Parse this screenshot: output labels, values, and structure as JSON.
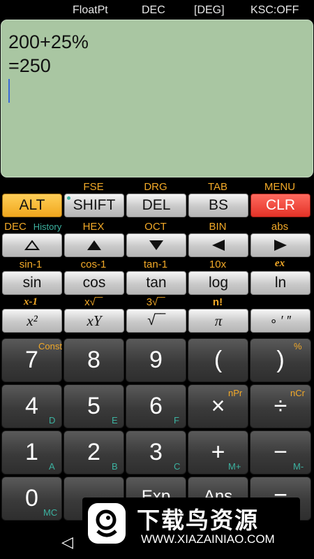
{
  "status": {
    "mode": "FloatPt",
    "base": "DEC",
    "angle": "[DEG]",
    "ksc": "KSC:OFF"
  },
  "display": {
    "expression": "200+25%",
    "result": "=250"
  },
  "row1": {
    "above": [
      "",
      "FSE",
      "DRG",
      "TAB",
      "MENU"
    ],
    "keys": [
      "ALT",
      "SHIFT",
      "DEL",
      "BS",
      "CLR"
    ]
  },
  "row2": {
    "above": [
      "DEC",
      "History",
      "HEX",
      "OCT",
      "BIN",
      "abs"
    ]
  },
  "row3": {
    "above": [
      "sin-1",
      "cos-1",
      "tan-1",
      "10x",
      "ex"
    ],
    "keys": [
      "sin",
      "cos",
      "tan",
      "log",
      "ln"
    ]
  },
  "row4": {
    "above": [
      "x-1",
      "x√‾‾",
      "3√‾‾",
      "n!",
      ""
    ],
    "keys": [
      "x²",
      "xY",
      "√‾‾",
      "π",
      "∘ ′ ″"
    ]
  },
  "digits": {
    "r1": {
      "keys": [
        "7",
        "8",
        "9",
        "(",
        ")"
      ],
      "sup": [
        "Const",
        "",
        "",
        "",
        "%"
      ]
    },
    "r2": {
      "keys": [
        "4",
        "5",
        "6",
        "×",
        "÷"
      ],
      "sup": [
        "",
        "",
        "",
        "nPr",
        "nCr"
      ],
      "sub": [
        "D",
        "E",
        "F",
        "",
        ""
      ]
    },
    "r3": {
      "keys": [
        "1",
        "2",
        "3",
        "+",
        "−"
      ],
      "sub": [
        "A",
        "B",
        "C",
        "M+",
        "M-"
      ]
    },
    "r4": {
      "keys": [
        "0",
        ".",
        "Exp",
        "Ans",
        "="
      ],
      "sub": [
        "MC",
        "",
        "",
        "",
        ""
      ]
    }
  },
  "watermark": {
    "cn": "下载鸟资源",
    "url": "WWW.XIAZAINIAO.COM"
  },
  "nav": {
    "back": "◁"
  },
  "colors": {
    "display_bg": "#a9c6a2",
    "alt_key": "#f0a71d",
    "clr_key": "#e33227",
    "shift_label": "#f2a928",
    "sub_label": "#3cb2a0"
  }
}
